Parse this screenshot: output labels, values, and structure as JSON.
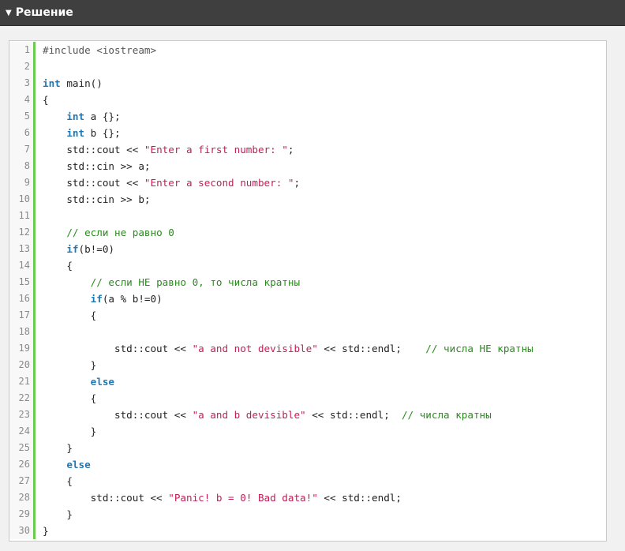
{
  "header": {
    "title": "Решение",
    "icon": "triangle-down-icon"
  },
  "colors": {
    "keyword": "#1f78b4",
    "string": "#c21e55",
    "comment": "#2a8a1e",
    "gutter_border": "#6ccc4f",
    "header_bg": "#3f3f3f"
  },
  "code_lines": [
    {
      "n": "1",
      "tokens": [
        {
          "t": "pp",
          "v": "#include <iostream>"
        }
      ]
    },
    {
      "n": "2",
      "tokens": []
    },
    {
      "n": "3",
      "tokens": [
        {
          "t": "kw",
          "v": "int"
        },
        {
          "t": "tx",
          "v": " main()"
        }
      ]
    },
    {
      "n": "4",
      "tokens": [
        {
          "t": "tx",
          "v": "{"
        }
      ]
    },
    {
      "n": "5",
      "tokens": [
        {
          "t": "tx",
          "v": "    "
        },
        {
          "t": "kw",
          "v": "int"
        },
        {
          "t": "tx",
          "v": " a {};"
        }
      ]
    },
    {
      "n": "6",
      "tokens": [
        {
          "t": "tx",
          "v": "    "
        },
        {
          "t": "kw",
          "v": "int"
        },
        {
          "t": "tx",
          "v": " b {};"
        }
      ]
    },
    {
      "n": "7",
      "tokens": [
        {
          "t": "tx",
          "v": "    std::cout << "
        },
        {
          "t": "str",
          "v": "\"Enter a first number: \""
        },
        {
          "t": "tx",
          "v": ";"
        }
      ]
    },
    {
      "n": "8",
      "tokens": [
        {
          "t": "tx",
          "v": "    std::cin >> a;"
        }
      ]
    },
    {
      "n": "9",
      "tokens": [
        {
          "t": "tx",
          "v": "    std::cout << "
        },
        {
          "t": "str",
          "v": "\"Enter a second number: \""
        },
        {
          "t": "tx",
          "v": ";"
        }
      ]
    },
    {
      "n": "10",
      "tokens": [
        {
          "t": "tx",
          "v": "    std::cin >> b;"
        }
      ]
    },
    {
      "n": "11",
      "tokens": []
    },
    {
      "n": "12",
      "tokens": [
        {
          "t": "tx",
          "v": "    "
        },
        {
          "t": "cm",
          "v": "// если не равно 0"
        }
      ]
    },
    {
      "n": "13",
      "tokens": [
        {
          "t": "tx",
          "v": "    "
        },
        {
          "t": "kw",
          "v": "if"
        },
        {
          "t": "tx",
          "v": "(b!=0)"
        }
      ]
    },
    {
      "n": "14",
      "tokens": [
        {
          "t": "tx",
          "v": "    {"
        }
      ]
    },
    {
      "n": "15",
      "tokens": [
        {
          "t": "tx",
          "v": "        "
        },
        {
          "t": "cm",
          "v": "// если НЕ равно 0, то числа кратны"
        }
      ]
    },
    {
      "n": "16",
      "tokens": [
        {
          "t": "tx",
          "v": "        "
        },
        {
          "t": "kw",
          "v": "if"
        },
        {
          "t": "tx",
          "v": "(a % b!=0)"
        }
      ]
    },
    {
      "n": "17",
      "tokens": [
        {
          "t": "tx",
          "v": "        {"
        }
      ]
    },
    {
      "n": "18",
      "tokens": []
    },
    {
      "n": "19",
      "tokens": [
        {
          "t": "tx",
          "v": "            std::cout << "
        },
        {
          "t": "str",
          "v": "\"a and not devisible\""
        },
        {
          "t": "tx",
          "v": " << std::endl;    "
        },
        {
          "t": "cm",
          "v": "// числа НЕ кратны"
        }
      ]
    },
    {
      "n": "20",
      "tokens": [
        {
          "t": "tx",
          "v": "        }"
        }
      ]
    },
    {
      "n": "21",
      "tokens": [
        {
          "t": "tx",
          "v": "        "
        },
        {
          "t": "kw",
          "v": "else"
        }
      ]
    },
    {
      "n": "22",
      "tokens": [
        {
          "t": "tx",
          "v": "        {"
        }
      ]
    },
    {
      "n": "23",
      "tokens": [
        {
          "t": "tx",
          "v": "            std::cout << "
        },
        {
          "t": "str",
          "v": "\"a and b devisible\""
        },
        {
          "t": "tx",
          "v": " << std::endl;  "
        },
        {
          "t": "cm",
          "v": "// числа кратны"
        }
      ]
    },
    {
      "n": "24",
      "tokens": [
        {
          "t": "tx",
          "v": "        }"
        }
      ]
    },
    {
      "n": "25",
      "tokens": [
        {
          "t": "tx",
          "v": "    }"
        }
      ]
    },
    {
      "n": "26",
      "tokens": [
        {
          "t": "tx",
          "v": "    "
        },
        {
          "t": "kw",
          "v": "else"
        }
      ]
    },
    {
      "n": "27",
      "tokens": [
        {
          "t": "tx",
          "v": "    {"
        }
      ]
    },
    {
      "n": "28",
      "tokens": [
        {
          "t": "tx",
          "v": "        std::cout << "
        },
        {
          "t": "str",
          "v": "\"Panic! b = 0! Bad data!\""
        },
        {
          "t": "tx",
          "v": " << std::endl;"
        }
      ]
    },
    {
      "n": "29",
      "tokens": [
        {
          "t": "tx",
          "v": "    }"
        }
      ]
    },
    {
      "n": "30",
      "tokens": [
        {
          "t": "tx",
          "v": "}"
        }
      ]
    }
  ]
}
